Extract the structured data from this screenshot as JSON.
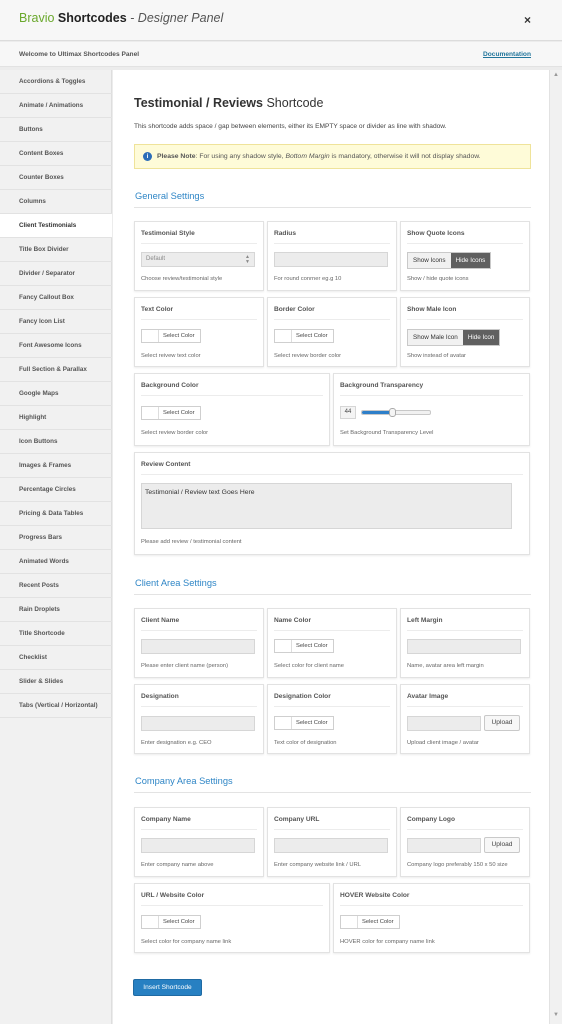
{
  "header": {
    "brand_1": "Bravio",
    "brand_2": "Shortcodes",
    "brand_3": "- Designer Panel",
    "close": "×"
  },
  "welcome": {
    "text": "Welcome to Ultimax Shortcodes Panel",
    "doc_link": "Documentation"
  },
  "sidebar": {
    "items": [
      "Accordions & Toggles",
      "Animate / Animations",
      "Buttons",
      "Content Boxes",
      "Counter Boxes",
      "Columns",
      "Client Testimonials",
      "Title Box Divider",
      "Divider / Separator",
      "Fancy Callout Box",
      "Fancy Icon List",
      "Font Awesome Icons",
      "Full Section & Parallax",
      "Google Maps",
      "Highlight",
      "Icon Buttons",
      "Images & Frames",
      "Percentage Circles",
      "Pricing & Data Tables",
      "Progress Bars",
      "Animated Words",
      "Recent Posts",
      "Rain Droplets",
      "Title Shortcode",
      "Checklist",
      "Slider & Slides",
      "Tabs (Vertical / Horizontal)"
    ],
    "active_index": 6
  },
  "page": {
    "title_bold": "Testimonial / Reviews",
    "title_rest": "Shortcode",
    "description": "This shortcode adds space / gap between elements, either its EMPTY space or divider as line with shadow.",
    "note_label": "Please Note",
    "note_text_1": ": For using any shadow style, ",
    "note_italic": "Bottom Margin",
    "note_text_2": " is mandatory, otherwise it will not display shadow."
  },
  "general": {
    "heading": "General Settings",
    "style_label": "Testimonial Style",
    "style_value": "Default",
    "style_desc": "Choose review/testimonial style",
    "radius_label": "Radius",
    "radius_desc": "For round conrner eg.g 10",
    "quote_label": "Show Quote Icons",
    "quote_show": "Show Icons",
    "quote_hide": "Hide Icons",
    "quote_desc": "Show / hide quote icons",
    "text_color_label": "Text Color",
    "text_color_desc": "Select reivew text color",
    "border_color_label": "Border Color",
    "border_color_desc": "Select review border color",
    "male_label": "Show Male Icon",
    "male_show": "Show Male Icon",
    "male_hide": "Hide Icon",
    "male_desc": "Show instead of avatar",
    "bg_color_label": "Background Color",
    "bg_color_desc": "Select review border color",
    "transparency_label": "Background Transparency",
    "transparency_value": "44",
    "transparency_fraction": 0.44,
    "transparency_desc": "Set Background Transparency Level",
    "content_label": "Review Content",
    "content_value": "Testimonial / Review text Goes Here",
    "content_desc": "Please add review / testimonial content"
  },
  "client": {
    "heading": "Client Area Settings",
    "name_label": "Client Name",
    "name_desc": "Please enter client name (person)",
    "name_color_label": "Name Color",
    "name_color_desc": "Select color for client name",
    "left_margin_label": "Left Margin",
    "left_margin_desc": "Name, avatar area left margin",
    "designation_label": "Designation",
    "designation_desc": "Enter designation e.g. CEO",
    "designation_color_label": "Designation Color",
    "designation_color_desc": "Text color of designation",
    "avatar_label": "Avatar Image",
    "avatar_desc": "Upload client image / avatar"
  },
  "company": {
    "heading": "Company Area Settings",
    "name_label": "Company Name",
    "name_desc": "Enter company name above",
    "url_label": "Company URL",
    "url_desc": "Enter company website link / URL",
    "logo_label": "Company Logo",
    "logo_desc": "Company logo preferably 150 x 50 size",
    "url_color_label": "URL / Website Color",
    "url_color_desc": "Select color for company name link",
    "hover_label": "HOVER Website Color",
    "hover_desc": "HOVER color for company name link"
  },
  "common": {
    "select_color": "Select Color",
    "upload": "Upload"
  },
  "insert_label": "Insert Shortcode",
  "colors": {
    "accent": "#2780c2",
    "brand_green": "#6aa82c",
    "section_heading": "#2f86c6",
    "note_bg": "#fefbd8"
  }
}
